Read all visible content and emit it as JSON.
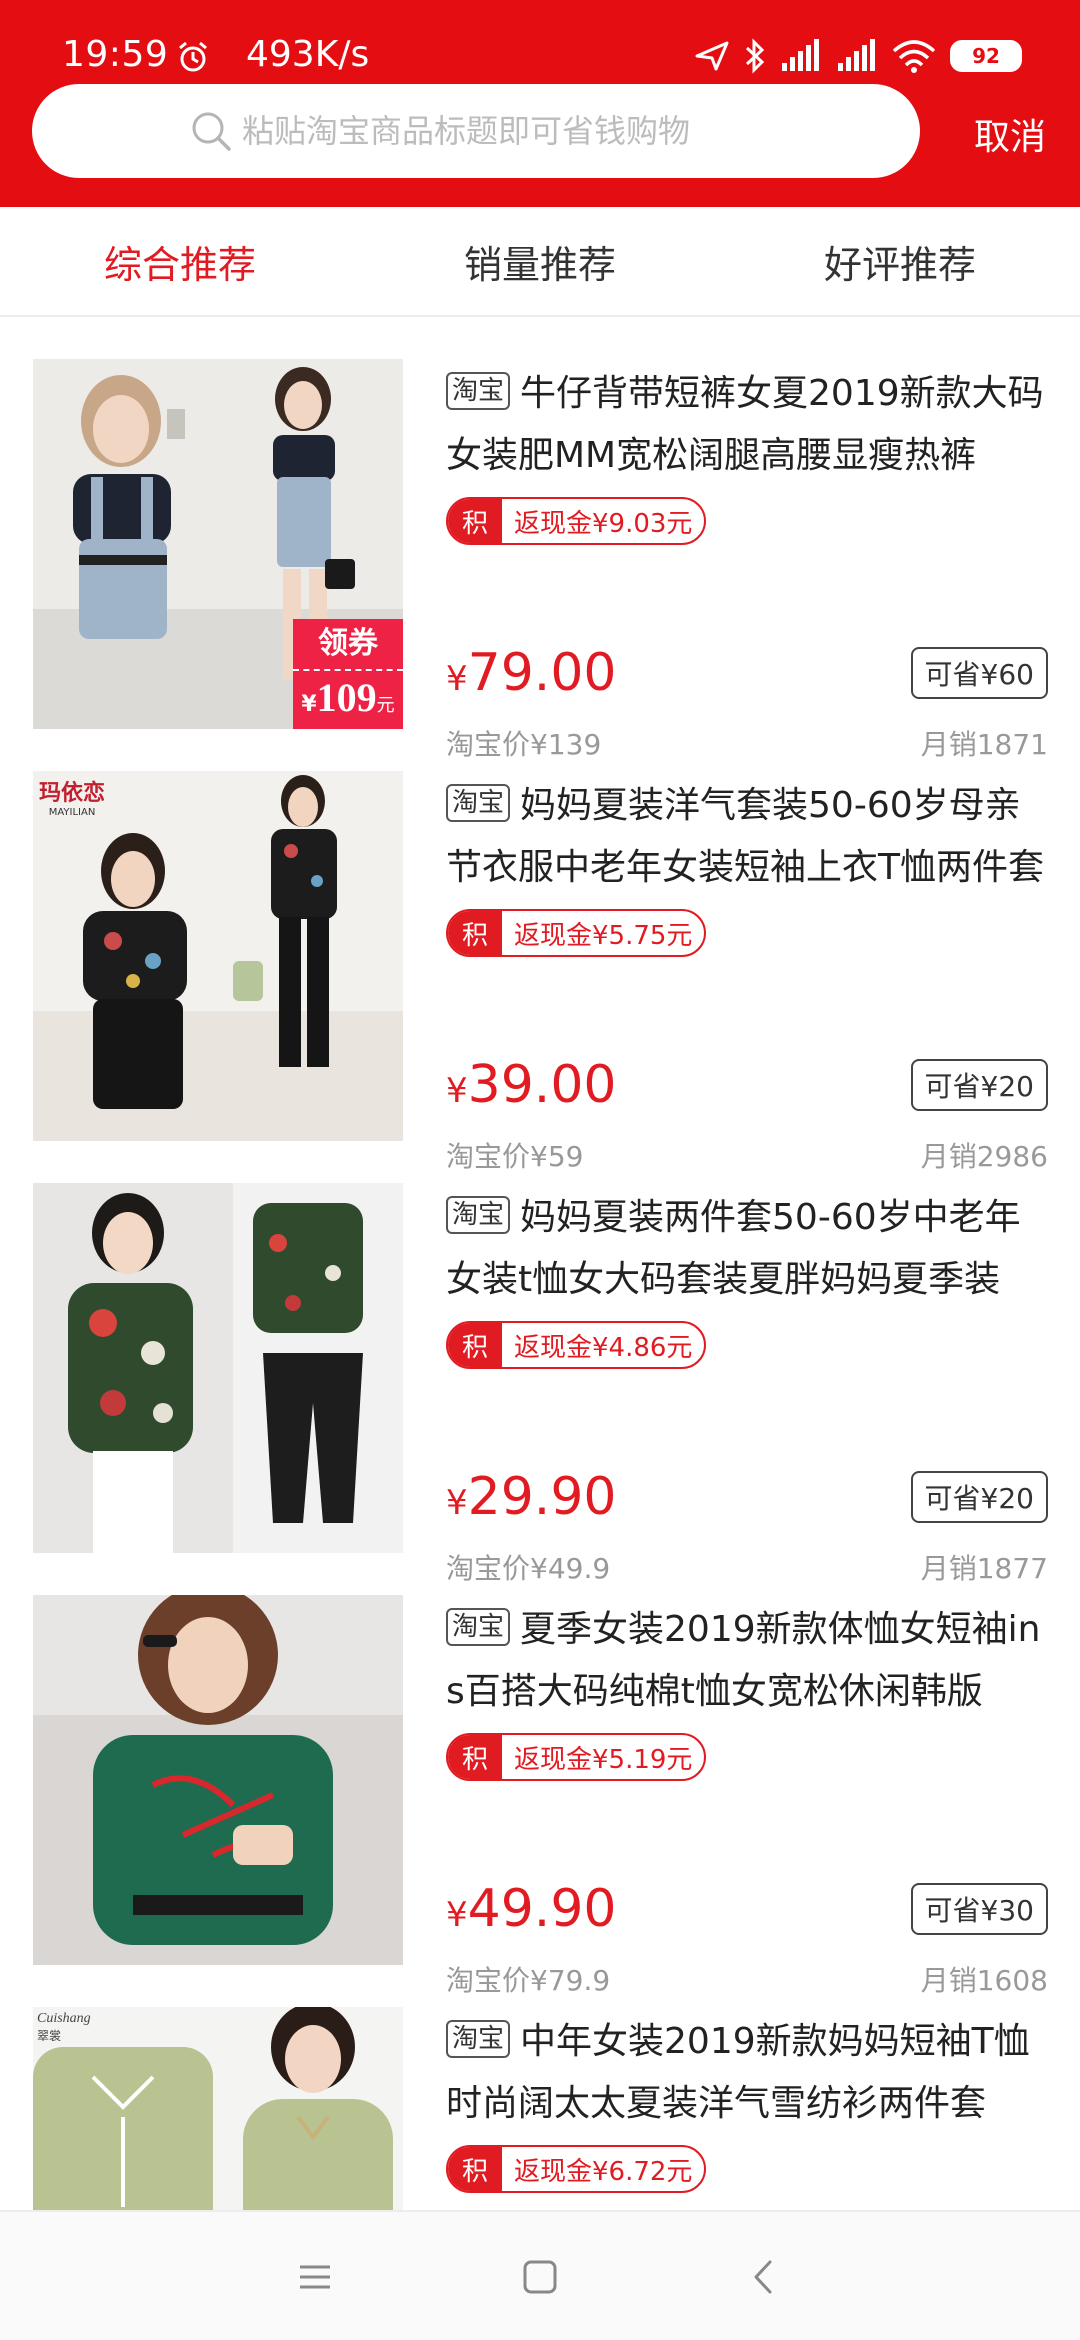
{
  "status_bar": {
    "time": "19:59",
    "speed": "493K/s",
    "battery": "92"
  },
  "search": {
    "placeholder": "粘贴淘宝商品标题即可省钱购物",
    "cancel_label": "取消"
  },
  "tabs": [
    {
      "label": "综合推荐",
      "active": true
    },
    {
      "label": "销量推荐",
      "active": false
    },
    {
      "label": "好评推荐",
      "active": false
    }
  ],
  "products": [
    {
      "source_tag": "淘宝",
      "title": "牛仔背带短裤女夏2019新款大码女装肥MM宽松阔腿高腰显瘦热裤",
      "cashback_badge": "积",
      "cashback": "返现金¥9.03元",
      "price_symbol": "¥",
      "price": "79.00",
      "save": "可省¥60",
      "taobao_price": "淘宝价¥139",
      "monthly_sales": "月销1871",
      "coupon_label": "领券",
      "coupon_price": "109",
      "coupon_yen": "¥",
      "coupon_unit": "元"
    },
    {
      "source_tag": "淘宝",
      "title": "妈妈夏装洋气套装50-60岁母亲节衣服中老年女装短袖上衣T恤两件套",
      "cashback_badge": "积",
      "cashback": "返现金¥5.75元",
      "price_symbol": "¥",
      "price": "39.00",
      "save": "可省¥20",
      "taobao_price": "淘宝价¥59",
      "monthly_sales": "月销2986",
      "brand": "玛依恋",
      "brand_en": "MAYILIAN"
    },
    {
      "source_tag": "淘宝",
      "title": "妈妈夏装两件套50-60岁中老年女装t恤女大码套装夏胖妈妈夏季装",
      "cashback_badge": "积",
      "cashback": "返现金¥4.86元",
      "price_symbol": "¥",
      "price": "29.90",
      "save": "可省¥20",
      "taobao_price": "淘宝价¥49.9",
      "monthly_sales": "月销1877"
    },
    {
      "source_tag": "淘宝",
      "title": "夏季女装2019新款体恤女短袖ins百搭大码纯棉t恤女宽松休闲韩版",
      "cashback_badge": "积",
      "cashback": "返现金¥5.19元",
      "price_symbol": "¥",
      "price": "49.90",
      "save": "可省¥30",
      "taobao_price": "淘宝价¥79.9",
      "monthly_sales": "月销1608"
    },
    {
      "source_tag": "淘宝",
      "title": "中年女装2019新款妈妈短袖T恤时尚阔太太夏装洋气雪纺衫两件套",
      "cashback_badge": "积",
      "cashback": "返现金¥6.72元",
      "brand": "Cuishang",
      "brand_cn": "翠裳"
    }
  ],
  "colors": {
    "brand_red": "#e40d12",
    "price_red": "#e11b22"
  }
}
